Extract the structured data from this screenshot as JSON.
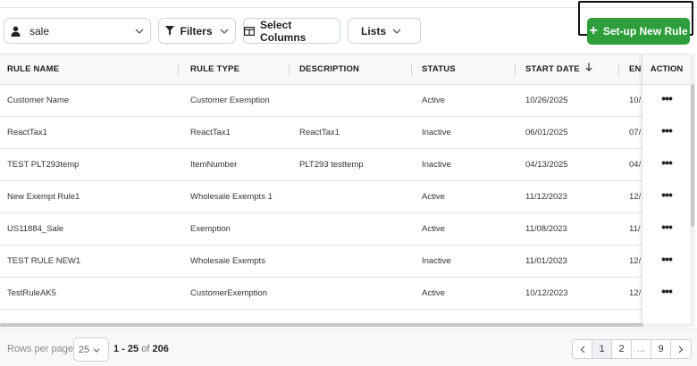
{
  "toolbar": {
    "user_select_value": "sale",
    "filters_label": "Filters",
    "select_columns_label": "Select Columns",
    "lists_label": "Lists",
    "new_rule_label": "Set-up New Rule"
  },
  "colors": {
    "accent": "#2e9e3a",
    "header_bg": "#f7f8f9"
  },
  "table": {
    "columns": {
      "rule_name": "RULE NAME",
      "rule_type": "RULE TYPE",
      "description": "DESCRIPTION",
      "status": "STATUS",
      "start_date": "START DATE",
      "end_date": "END",
      "action": "ACTION"
    },
    "sort": {
      "column": "start_date",
      "direction": "descending"
    },
    "rows": [
      {
        "name": "Customer Name",
        "type": "Customer Exemption",
        "description": "",
        "status": "Active",
        "start": "10/26/2025",
        "end": "10/"
      },
      {
        "name": "ReactTax1",
        "type": "ReactTax1",
        "description": "ReactTax1",
        "status": "Inactive",
        "start": "06/01/2025",
        "end": "07/"
      },
      {
        "name": "TEST PLT293temp",
        "type": "ItemNumber",
        "description": "PLT293 testtemp",
        "status": "Inactive",
        "start": "04/13/2025",
        "end": "04/"
      },
      {
        "name": "New Exempt Rule1",
        "type": "Wholesale Exempts 1",
        "description": "",
        "status": "Active",
        "start": "11/12/2023",
        "end": "12/"
      },
      {
        "name": "US11884_Sale",
        "type": "Exemption",
        "description": "",
        "status": "Active",
        "start": "11/08/2023",
        "end": "11/"
      },
      {
        "name": "TEST RULE NEW1",
        "type": "Wholesale Exempts",
        "description": "",
        "status": "Inactive",
        "start": "11/01/2023",
        "end": "12/"
      },
      {
        "name": "TestRuleAK5",
        "type": "CustomerExemption",
        "description": "",
        "status": "Active",
        "start": "10/12/2023",
        "end": "12/"
      }
    ],
    "action_glyph": "•••"
  },
  "footer": {
    "rows_per_page_label": "Rows per page",
    "rows_per_page_value": "25",
    "range": "1 - 25",
    "of_label": "of",
    "total": "206",
    "pages": [
      "1",
      "2",
      "...",
      "9"
    ]
  }
}
